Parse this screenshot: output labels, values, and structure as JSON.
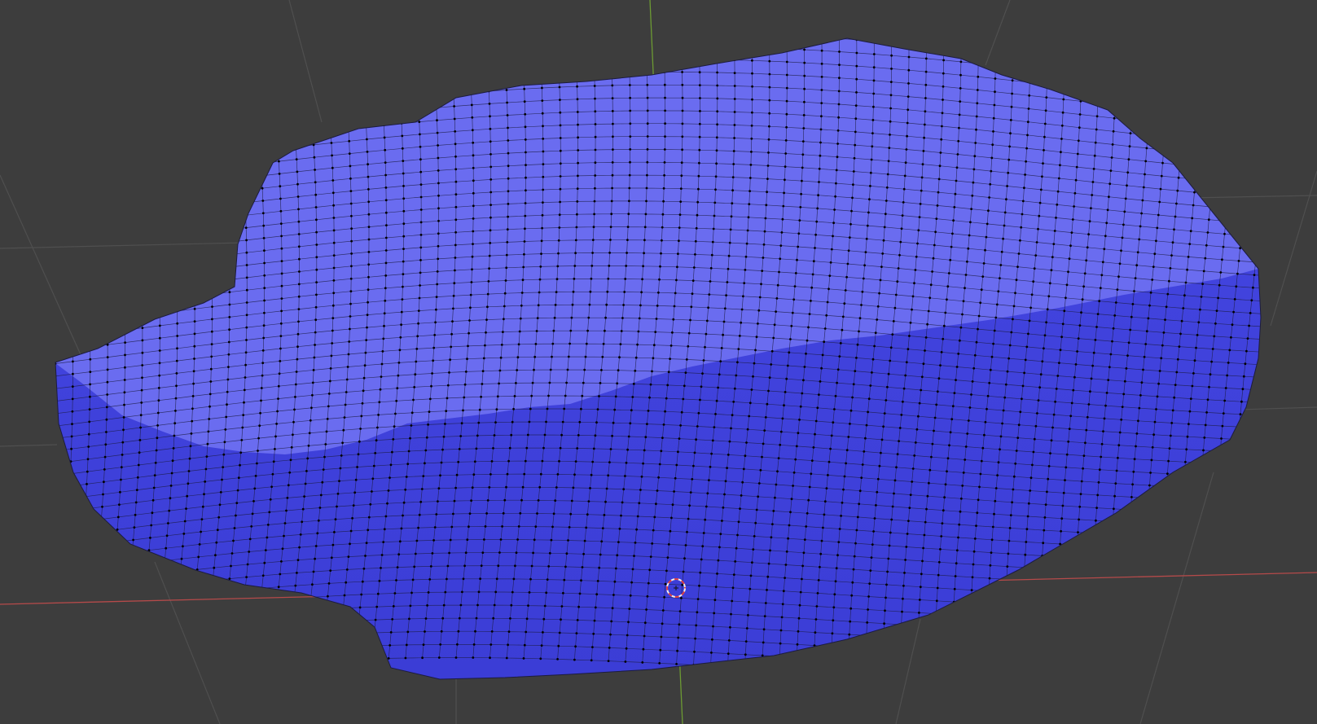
{
  "viewport": {
    "background": "#3d3d3d",
    "grid_color": "#4f4f4f",
    "x_axis_color": "#b54a4a",
    "y_axis_color": "#6c9a33",
    "mode": "edit-mode"
  },
  "mesh": {
    "object": "rock",
    "select_mode": "vertex",
    "top_color": "#6a6cf0",
    "face_color": "#4749e6",
    "dark_color": "#3a3cd6",
    "edge_color": "#1c1c40",
    "vertex_color": "#000000",
    "all_selected": false
  },
  "cursor_3d": {
    "icon": "3d-cursor-icon",
    "ring_colors": [
      "#e04040",
      "#f0f0f0"
    ]
  }
}
